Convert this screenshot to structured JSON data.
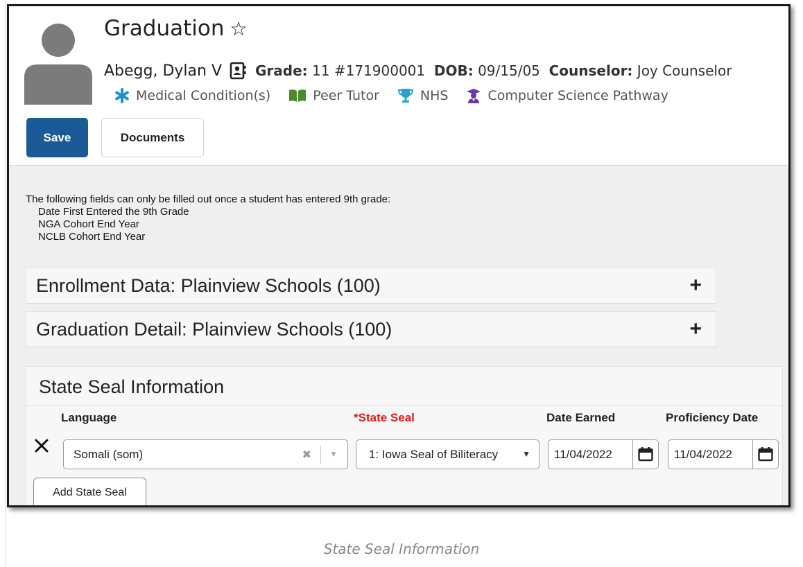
{
  "header": {
    "title": "Graduation",
    "student": {
      "name": "Abegg, Dylan V",
      "grade_label": "Grade:",
      "grade_value": "11 #171900001",
      "dob_label": "DOB:",
      "dob_value": "09/15/05",
      "counselor_label": "Counselor:",
      "counselor_value": "Joy Counselor"
    },
    "flags": [
      {
        "label": "Medical Condition(s)",
        "icon": "asterisk-icon",
        "color": "#1e8fd6"
      },
      {
        "label": "Peer Tutor",
        "icon": "book-icon",
        "color": "#4a8a2a"
      },
      {
        "label": "NHS",
        "icon": "trophy-icon",
        "color": "#2aa0c8"
      },
      {
        "label": "Computer Science Pathway",
        "icon": "graduate-icon",
        "color": "#6a3aa8"
      }
    ]
  },
  "toolbar": {
    "save_label": "Save",
    "documents_label": "Documents"
  },
  "notice": {
    "heading": "The following fields can only be filled out once a student has entered 9th grade:",
    "items": [
      "Date First Entered the 9th Grade",
      "NGA Cohort End Year",
      "NCLB Cohort End Year"
    ]
  },
  "sections": {
    "enrollment": "Enrollment Data: Plainview Schools (100)",
    "graduation": "Graduation Detail: Plainview Schools (100)",
    "expand_symbol": "+"
  },
  "state_seal": {
    "title": "State Seal Information",
    "columns": {
      "language": "Language",
      "state_seal": "*State Seal",
      "date_earned": "Date Earned",
      "proficiency_date": "Proficiency Date"
    },
    "row": {
      "language": "Somali (som)",
      "state_seal": "1: Iowa Seal of Biliteracy",
      "date_earned": "11/04/2022",
      "proficiency_date": "11/04/2022"
    },
    "add_label": "Add State Seal"
  },
  "caption": "State Seal Information",
  "colors": {
    "primary": "#1a5a96",
    "required": "#e01e1e"
  }
}
